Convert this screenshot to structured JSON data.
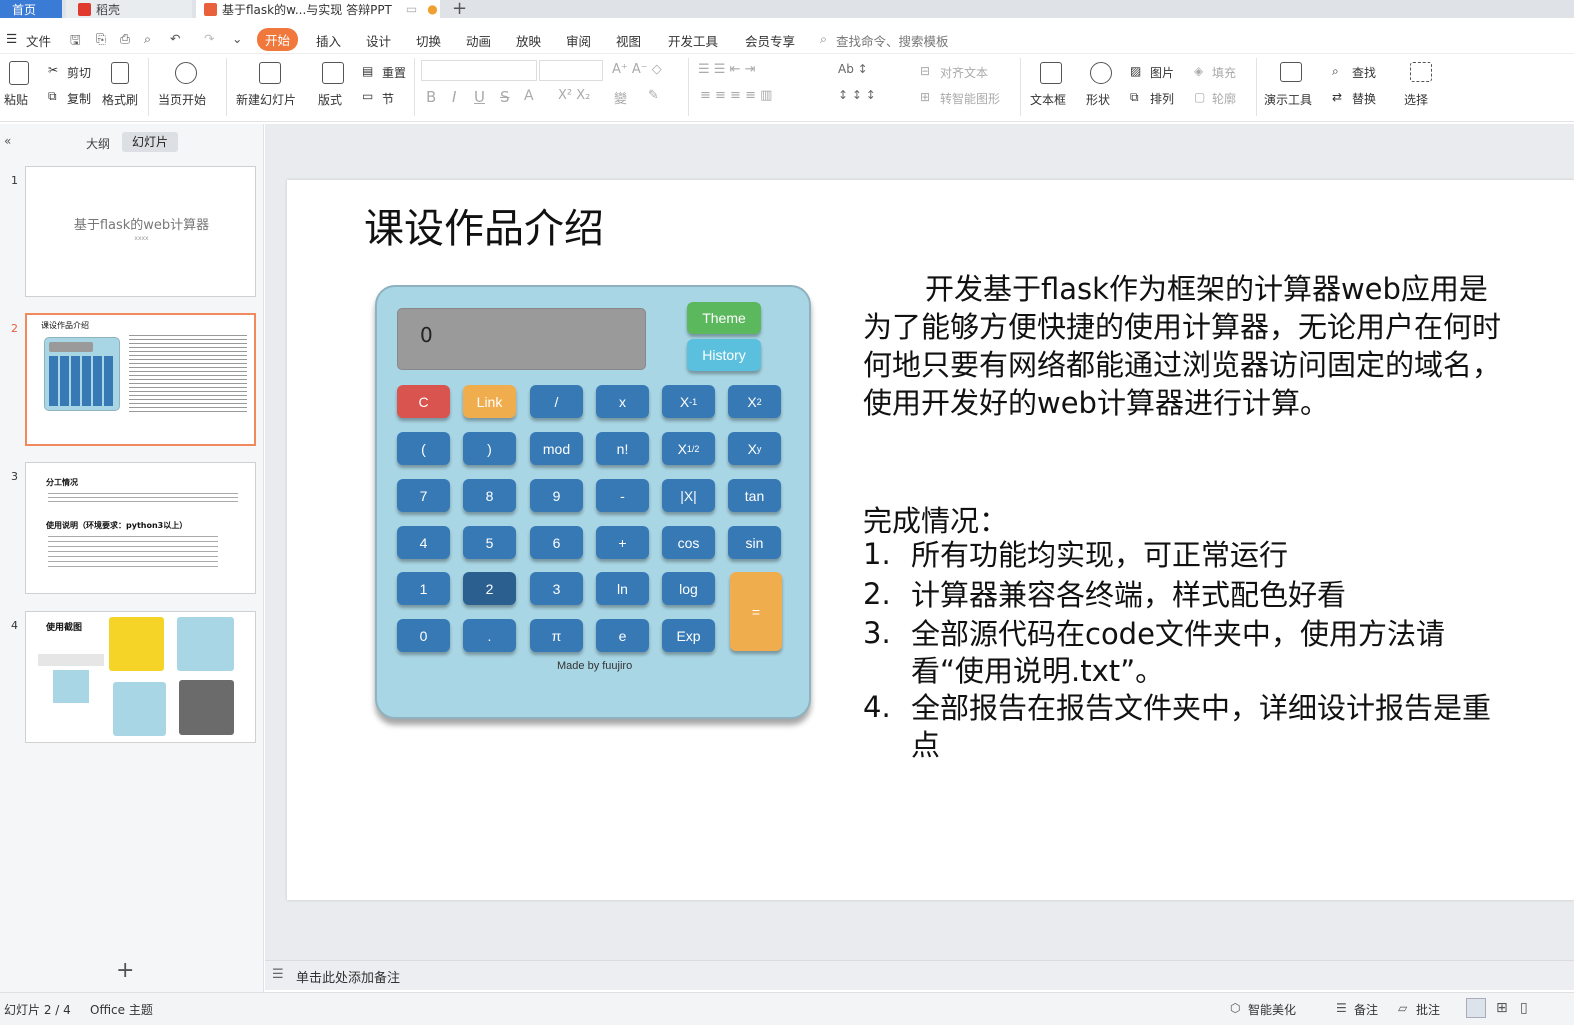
{
  "tabs": {
    "home": "首页",
    "daoke": "稻壳",
    "doc": "基于flask的w...与实现 答辩PPT"
  },
  "menu": {
    "file": "文件",
    "items": [
      "开始",
      "插入",
      "设计",
      "切换",
      "动画",
      "放映",
      "审阅",
      "视图",
      "开发工具",
      "会员专享"
    ],
    "search": "查找命令、搜索模板"
  },
  "ribbon": {
    "paste": "粘贴",
    "cut": "剪切",
    "copy": "复制",
    "format_brush": "格式刷",
    "play_from": "当页开始",
    "new_slide": "新建幻灯片",
    "layout": "版式",
    "reset": "重置",
    "section": "节",
    "align_text": "对齐文本",
    "to_smartart": "转智能图形",
    "textbox": "文本框",
    "shape": "形状",
    "picture": "图片",
    "arrange": "排列",
    "fill": "填充",
    "outline": "轮廓",
    "present_tools": "演示工具",
    "find": "查找",
    "replace": "替换",
    "select": "选择"
  },
  "panel": {
    "outline_tab": "大纲",
    "slides_tab": "幻灯片"
  },
  "thumbs": {
    "t1_num": "1",
    "t1_title": "基于flask的web计算器",
    "t1_sub": "xxxx",
    "t2_num": "2",
    "t2_title": "课设作品介绍",
    "t3_num": "3",
    "t3_title": "分工情况",
    "t3_title2": "使用说明（环境要求：python3以上）",
    "t4_num": "4",
    "t4_title": "使用截图"
  },
  "slide": {
    "title": "课设作品介绍",
    "para": "开发基于flask作为框架的计算器web应用是为了能够方便快捷的使用计算器，无论用户在何时何地只要有网络都能通过浏览器访问固定的域名，使用开发好的web计算器进行计算。",
    "status_heading": "完成情况：",
    "items": [
      "所有功能均实现，可正常运行",
      "计算器兼容各终端，样式配色好看",
      "全部源代码在code文件夹中，使用方法请看“使用说明.txt”。",
      "全部报告在报告文件夹中，详细设计报告是重点"
    ],
    "item_nums": [
      "1.",
      "2.",
      "3.",
      "4."
    ]
  },
  "calc": {
    "display": "0",
    "theme": "Theme",
    "history": "History",
    "credit": "Made by fuujiro",
    "rows": [
      [
        "C",
        "Link",
        "/",
        "x",
        "X-1",
        "X2"
      ],
      [
        "(",
        ")",
        "mod",
        "n!",
        "X1/2",
        "Xy"
      ],
      [
        "7",
        "8",
        "9",
        "-",
        "|X|",
        "tan"
      ],
      [
        "4",
        "5",
        "6",
        "+",
        "cos",
        "sin"
      ],
      [
        "1",
        "2",
        "3",
        "ln",
        "log"
      ],
      [
        "0",
        ".",
        "π",
        "e",
        "Exp"
      ]
    ],
    "equals": "="
  },
  "notes": "单击此处添加备注",
  "status": {
    "slide": "幻灯片 2 / 4",
    "theme": "Office 主题",
    "beautify": "智能美化",
    "note": "备注",
    "comment": "批注"
  },
  "colors": {
    "accent": "#f0783c",
    "calc_bg": "#a9d6e5",
    "btn": "#3779b5",
    "red": "#d9534f",
    "orange": "#f0ad4e",
    "green": "#5cb85c",
    "cyan": "#5bc0de"
  }
}
